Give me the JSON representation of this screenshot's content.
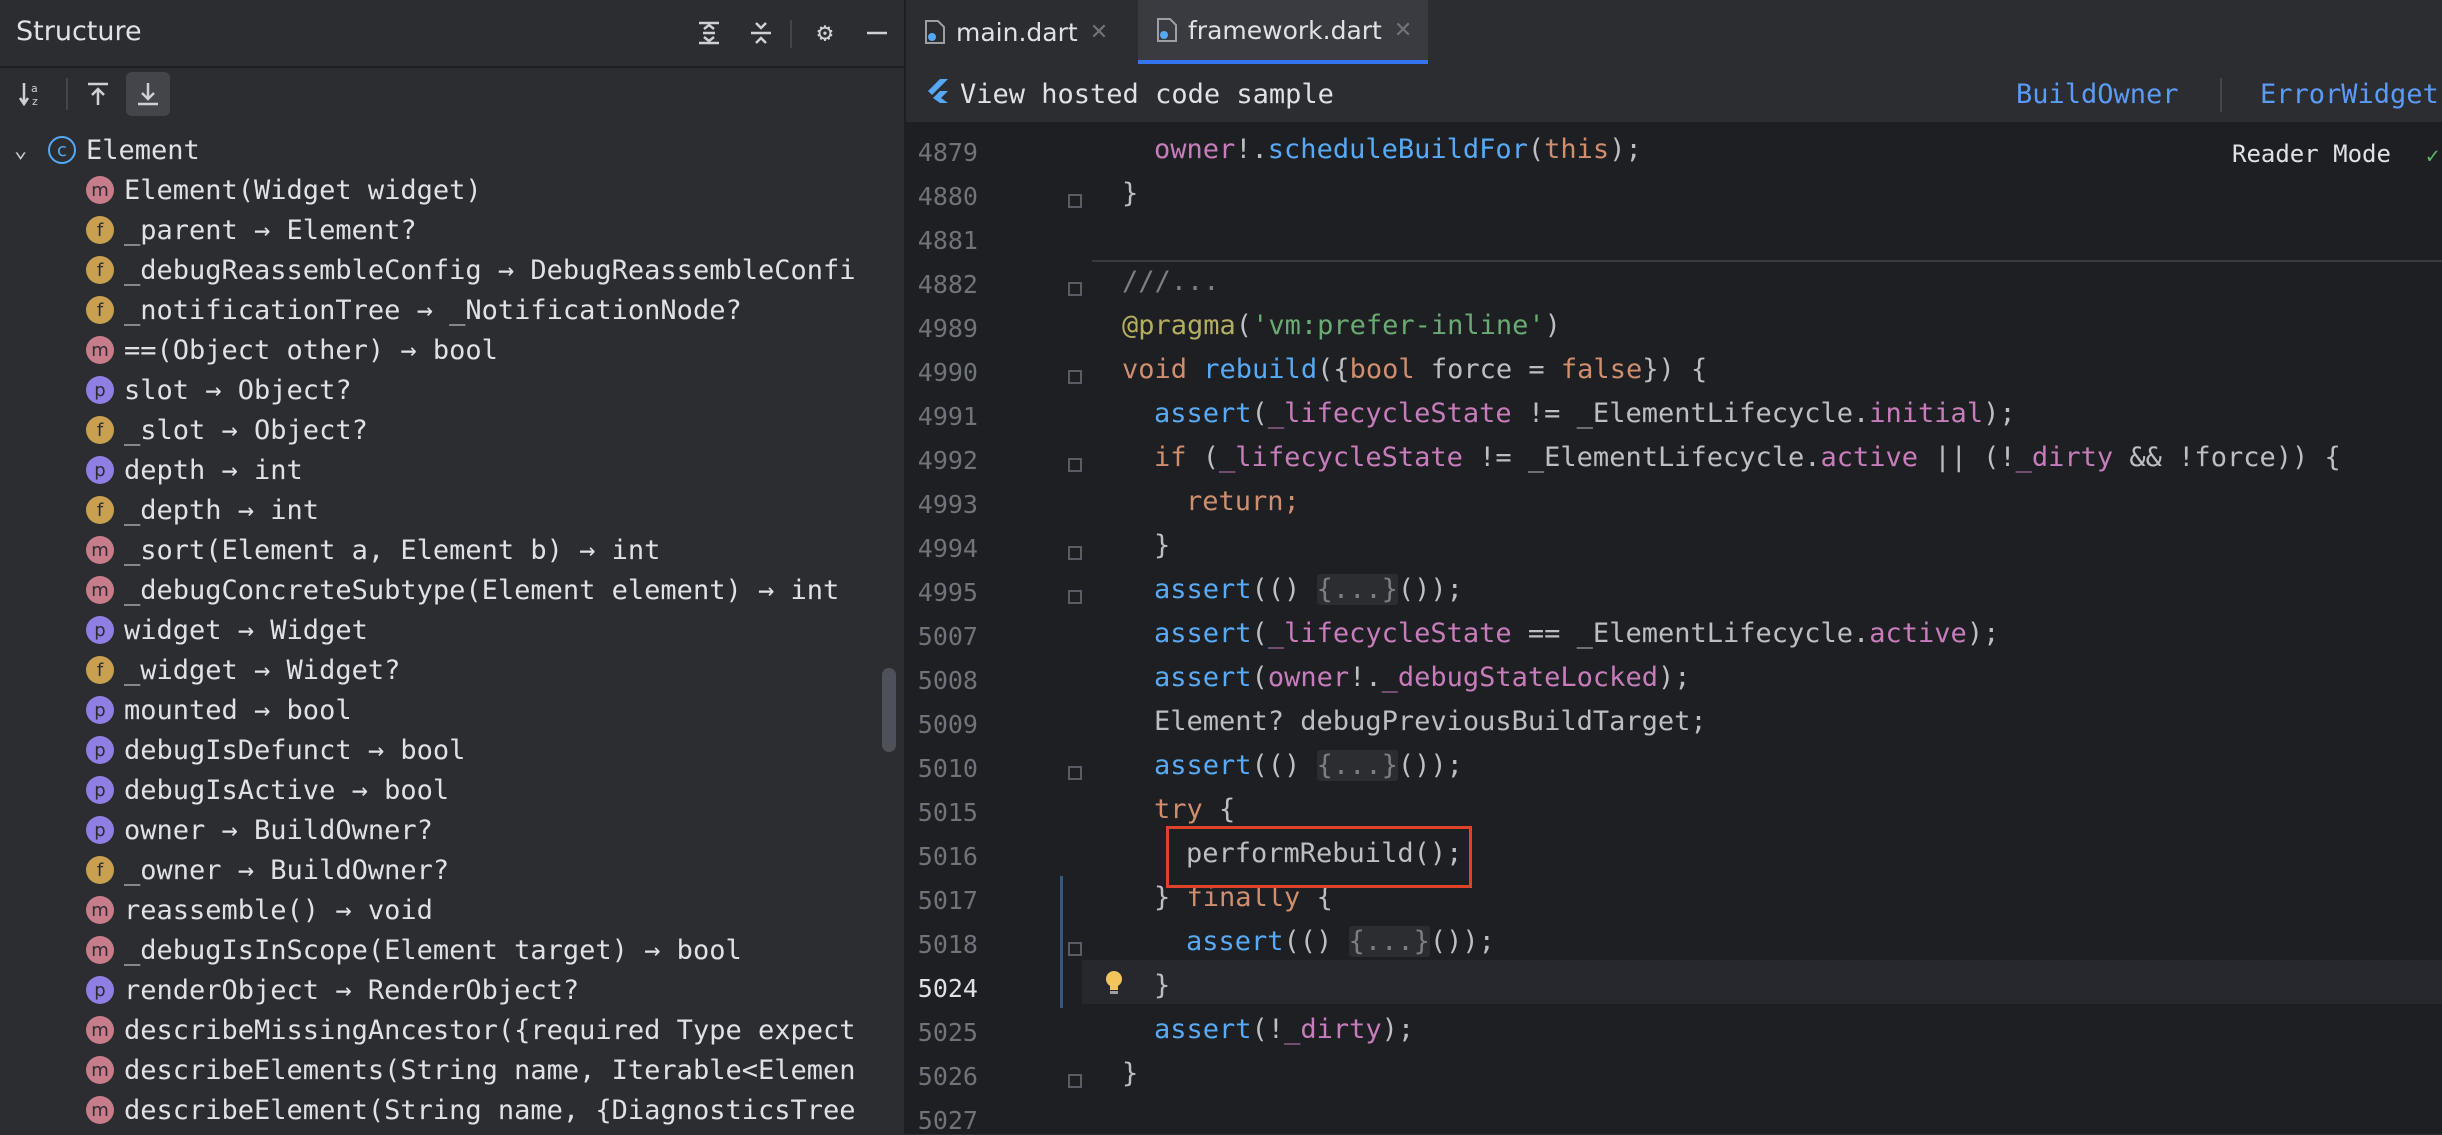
{
  "structure": {
    "title": "Structure",
    "root": "Element",
    "items": [
      {
        "kind": "m",
        "text": "Element(Widget widget)"
      },
      {
        "kind": "f",
        "text": "_parent → Element?"
      },
      {
        "kind": "f",
        "text": "_debugReassembleConfig → DebugReassembleConfi"
      },
      {
        "kind": "f",
        "text": "_notificationTree → _NotificationNode?"
      },
      {
        "kind": "m",
        "text": "==(Object other) → bool"
      },
      {
        "kind": "p",
        "text": "slot → Object?"
      },
      {
        "kind": "f",
        "text": "_slot → Object?"
      },
      {
        "kind": "p",
        "text": "depth → int"
      },
      {
        "kind": "f",
        "text": "_depth → int"
      },
      {
        "kind": "m",
        "text": "_sort(Element a, Element b) → int"
      },
      {
        "kind": "m",
        "text": "_debugConcreteSubtype(Element element) → int"
      },
      {
        "kind": "p",
        "text": "widget → Widget"
      },
      {
        "kind": "f",
        "text": "_widget → Widget?"
      },
      {
        "kind": "p",
        "text": "mounted → bool"
      },
      {
        "kind": "p",
        "text": "debugIsDefunct → bool"
      },
      {
        "kind": "p",
        "text": "debugIsActive → bool"
      },
      {
        "kind": "p",
        "text": "owner → BuildOwner?"
      },
      {
        "kind": "f",
        "text": "_owner → BuildOwner?"
      },
      {
        "kind": "m",
        "text": "reassemble() → void"
      },
      {
        "kind": "m",
        "text": "_debugIsInScope(Element target) → bool"
      },
      {
        "kind": "p",
        "text": "renderObject → RenderObject?"
      },
      {
        "kind": "m",
        "text": "describeMissingAncestor({required Type expect"
      },
      {
        "kind": "m",
        "text": "describeElements(String name, Iterable<Elemen"
      },
      {
        "kind": "m",
        "text": "describeElement(String name, {DiagnosticsTree"
      }
    ]
  },
  "tabs": [
    {
      "label": "main.dart",
      "active": false
    },
    {
      "label": "framework.dart",
      "active": true
    }
  ],
  "banner": {
    "text": "View hosted code sample",
    "link1": "BuildOwner",
    "link2": "ErrorWidget"
  },
  "editor": {
    "reader_mode": "Reader Mode",
    "line_numbers": [
      "4879",
      "4880",
      "4881",
      "4882",
      "4989",
      "4990",
      "4991",
      "4992",
      "4993",
      "4994",
      "4995",
      "5007",
      "5008",
      "5009",
      "5010",
      "5015",
      "5016",
      "5017",
      "5018",
      "5024",
      "5025",
      "5026",
      "5027"
    ],
    "current_line": "5024"
  },
  "code": {
    "l4879_a": "owner",
    "l4879_b": "!.",
    "l4879_c": "scheduleBuildFor",
    "l4879_d": "(",
    "l4879_e": "this",
    "l4879_f": ");",
    "l4880": "}",
    "l4882": "///...",
    "l4989_a": "@pragma",
    "l4989_b": "(",
    "l4989_c": "'vm:prefer-inline'",
    "l4989_d": ")",
    "l4990_a": "void ",
    "l4990_b": "rebuild",
    "l4990_c": "({",
    "l4990_d": "bool ",
    "l4990_e": "force = ",
    "l4990_f": "false",
    "l4990_g": "}) {",
    "l4991_a": "assert",
    "l4991_b": "(",
    "l4991_c": "_lifecycleState",
    "l4991_d": " != _ElementLifecycle.",
    "l4991_e": "initial",
    "l4991_f": ");",
    "l4992_a": "if ",
    "l4992_b": "(",
    "l4992_c": "_lifecycleState",
    "l4992_d": " != _ElementLifecycle.",
    "l4992_e": "active",
    "l4992_f": " || (!",
    "l4992_g": "_dirty",
    "l4992_h": " && !force)) {",
    "l4993": "return;",
    "l4994": "}",
    "l4995_a": "assert",
    "l4995_b": "(() ",
    "l4995_c": "{...}",
    "l4995_d": "());",
    "l5007_a": "assert",
    "l5007_b": "(",
    "l5007_c": "_lifecycleState",
    "l5007_d": " == _ElementLifecycle.",
    "l5007_e": "active",
    "l5007_f": ");",
    "l5008_a": "assert",
    "l5008_b": "(",
    "l5008_c": "owner",
    "l5008_d": "!.",
    "l5008_e": "_debugStateLocked",
    "l5008_f": ");",
    "l5009": "Element? debugPreviousBuildTarget;",
    "l5010_a": "assert",
    "l5010_b": "(() ",
    "l5010_c": "{...}",
    "l5010_d": "());",
    "l5015_a": "try ",
    "l5015_b": "{",
    "l5016": "performRebuild();",
    "l5017_a": "} ",
    "l5017_b": "finally ",
    "l5017_c": "{",
    "l5018_a": "assert",
    "l5018_b": "(() ",
    "l5018_c": "{...}",
    "l5018_d": "());",
    "l5024": "}",
    "l5025_a": "assert",
    "l5025_b": "(!",
    "l5025_c": "_dirty",
    "l5025_d": ");",
    "l5026": "}"
  }
}
